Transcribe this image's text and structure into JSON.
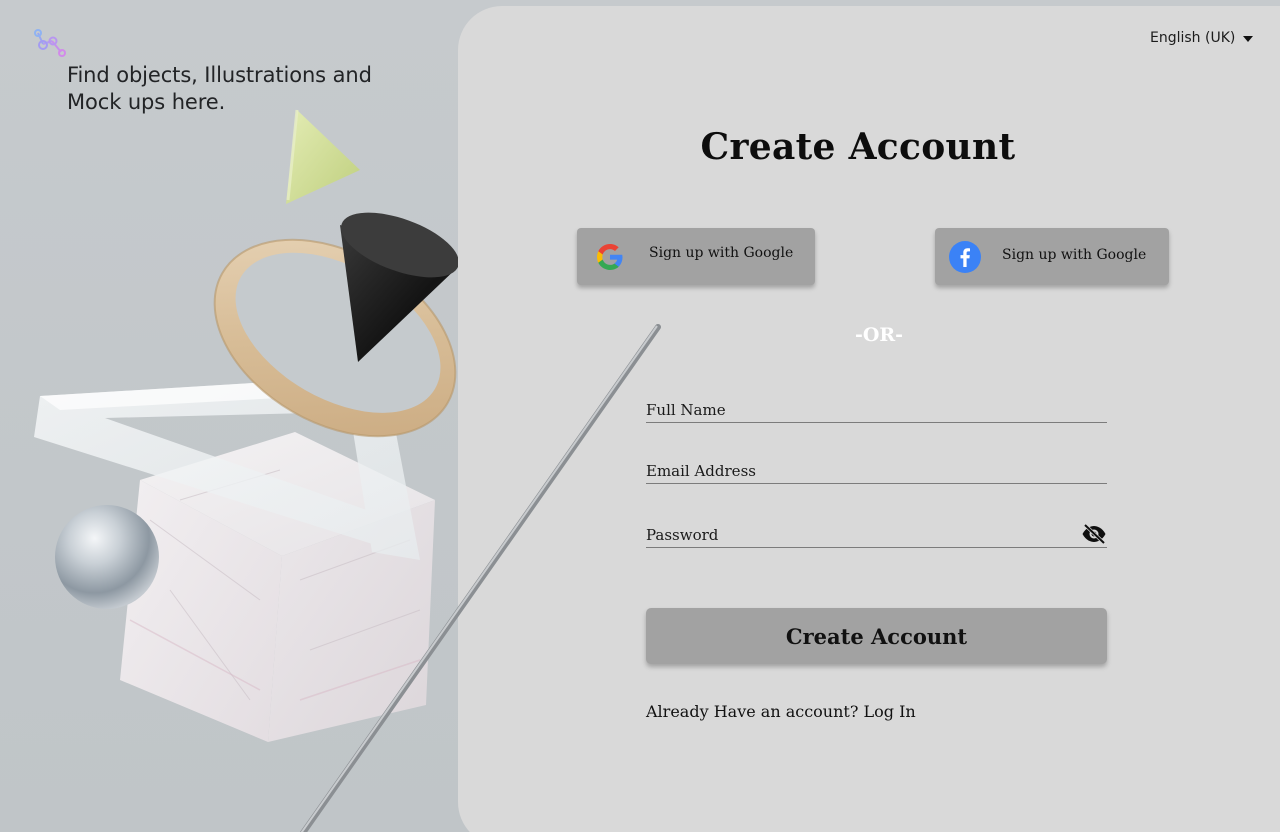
{
  "hero": {
    "tagline": "Find objects, Illustrations and Mock ups here.",
    "logo_icon": "molecule-logo-icon"
  },
  "header": {
    "language": "English (UK)",
    "language_icon": "caret-down-icon"
  },
  "form": {
    "title": "Create Account",
    "social": {
      "google_label": "Sign up with Google",
      "google_icon": "google-icon",
      "facebook_label": "Sign up with Google",
      "facebook_icon": "facebook-icon"
    },
    "divider": "-OR-",
    "fields": {
      "full_name_placeholder": "Full Name",
      "full_name_value": "",
      "email_placeholder": "Email Address",
      "email_value": "",
      "password_placeholder": "Password",
      "password_value": "",
      "password_toggle_icon": "eye-off-icon"
    },
    "submit_label": "Create Account",
    "login_prompt": "Already Have an account?",
    "login_link": "Log In"
  },
  "colors": {
    "background": "#c3c8cc",
    "panel": "#d9d9d9",
    "button": "#a2a2a2",
    "divider_text": "#ffffff",
    "facebook_blue": "#3b82f6"
  }
}
